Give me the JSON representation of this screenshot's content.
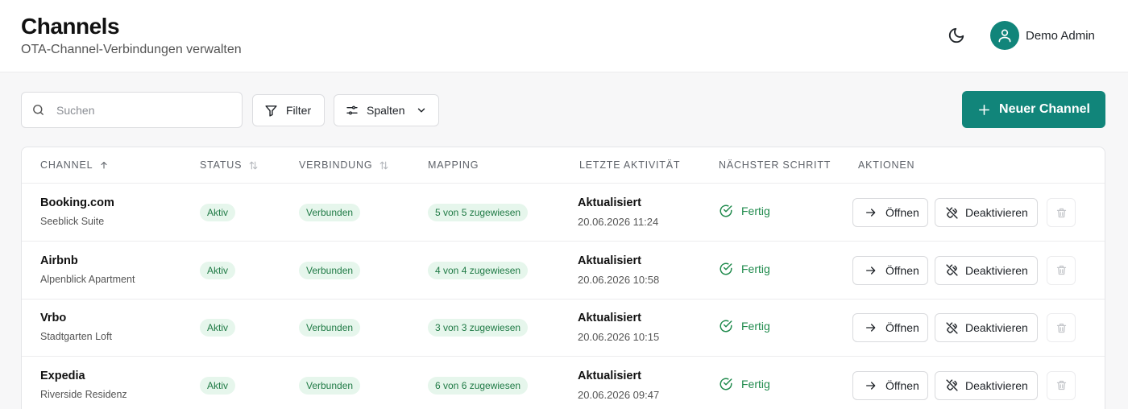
{
  "header": {
    "title": "Channels",
    "subtitle": "OTA-Channel-Verbindungen verwalten",
    "theme_icon": "moon-icon",
    "user_name": "Demo Admin",
    "avatar_icon": "user-icon"
  },
  "toolbar": {
    "search_placeholder": "Suchen",
    "search_value": "",
    "filter_label": "Filter",
    "columns_label": "Spalten",
    "new_label": "Neuer Channel"
  },
  "colors": {
    "accent": "#11857a",
    "status_green_bg": "#e6f6ec",
    "status_green_text": "#1f7a45"
  },
  "table": {
    "headers": {
      "channel": "CHANNEL",
      "status": "STATUS",
      "connection": "VERBINDUNG",
      "mapping": "MAPPING",
      "last_activity": "LETZTE AKTIVITÄT",
      "next_step": "NÄCHSTER SCHRITT",
      "actions": "AKTIONEN"
    },
    "open_label": "Öffnen",
    "deactivate_label": "Deaktivieren",
    "rows": [
      {
        "name": "Booking.com",
        "property": "Seeblick Suite",
        "status": "Aktiv",
        "connection": "Verbunden",
        "mapping": "5 von 5 zugewiesen",
        "activity_title": "Aktualisiert",
        "activity_time": "20.06.2026 11:24",
        "next_step": "Fertig"
      },
      {
        "name": "Airbnb",
        "property": "Alpenblick Apartment",
        "status": "Aktiv",
        "connection": "Verbunden",
        "mapping": "4 von 4 zugewiesen",
        "activity_title": "Aktualisiert",
        "activity_time": "20.06.2026 10:58",
        "next_step": "Fertig"
      },
      {
        "name": "Vrbo",
        "property": "Stadtgarten Loft",
        "status": "Aktiv",
        "connection": "Verbunden",
        "mapping": "3 von 3 zugewiesen",
        "activity_title": "Aktualisiert",
        "activity_time": "20.06.2026 10:15",
        "next_step": "Fertig"
      },
      {
        "name": "Expedia",
        "property": "Riverside Residenz",
        "status": "Aktiv",
        "connection": "Verbunden",
        "mapping": "6 von 6 zugewiesen",
        "activity_title": "Aktualisiert",
        "activity_time": "20.06.2026 09:47",
        "next_step": "Fertig"
      }
    ]
  }
}
